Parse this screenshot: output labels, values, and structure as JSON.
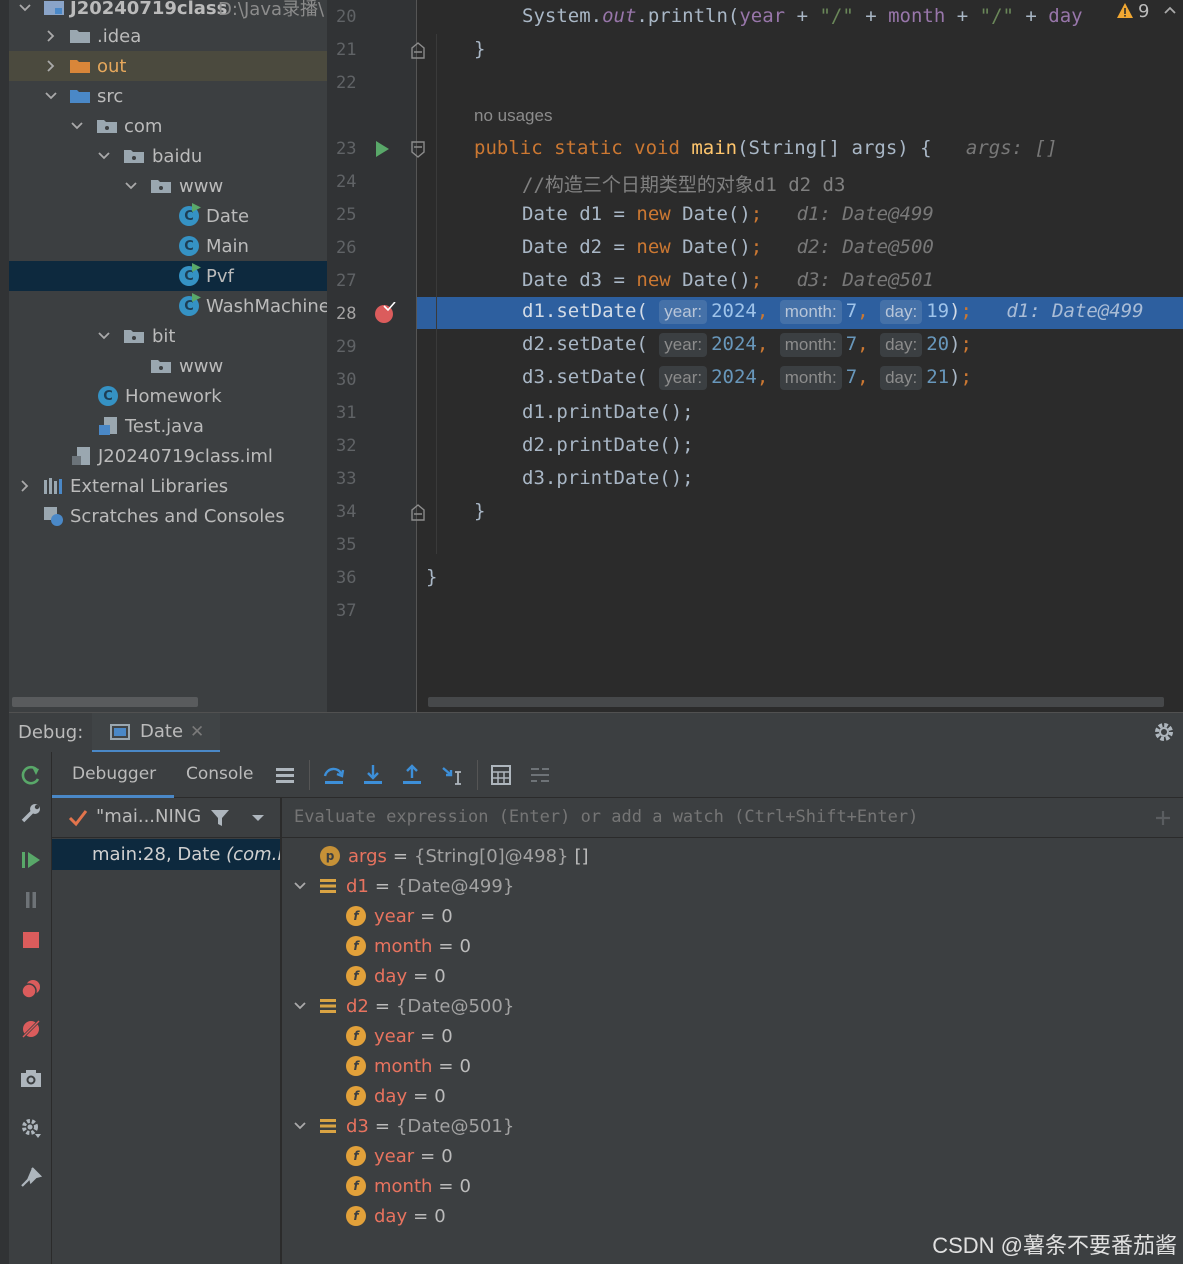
{
  "project_tree": {
    "items": [
      {
        "label": "J20240719class",
        "path": "D:\\Java录播\\"
      },
      {
        "label": ".idea"
      },
      {
        "label": "out"
      },
      {
        "label": "src"
      },
      {
        "label": "com"
      },
      {
        "label": "baidu"
      },
      {
        "label": "www"
      },
      {
        "label": "Date"
      },
      {
        "label": "Main"
      },
      {
        "label": "Pvf"
      },
      {
        "label": "WashMachine"
      },
      {
        "label": "bit"
      },
      {
        "label": "www"
      },
      {
        "label": "Homework"
      },
      {
        "label": "Test.java"
      },
      {
        "label": "J20240719class.iml"
      },
      {
        "label": "External Libraries"
      },
      {
        "label": "Scratches and Consoles"
      }
    ]
  },
  "editor": {
    "warnings_count": "9",
    "line_numbers": [
      "20",
      "21",
      "22",
      "23",
      "24",
      "25",
      "26",
      "27",
      "28",
      "29",
      "30",
      "31",
      "32",
      "33",
      "34",
      "35",
      "36",
      "37"
    ],
    "no_usages": "no usages",
    "inlay_args": "args: []",
    "comment": "//构造三个日期类型的对象d1 d2 d3",
    "inlay_d1": "d1: Date@499",
    "inlay_d2": "d2: Date@500",
    "inlay_d3": "d3: Date@501",
    "inlay_exec": "d1: Date@499",
    "hint_year": "year:",
    "hint_month": "month:",
    "hint_day": "day:",
    "calls": [
      {
        "obj": "d1",
        "year": "2024",
        "month": "7",
        "day": "19"
      },
      {
        "obj": "d2",
        "year": "2024",
        "month": "7",
        "day": "20"
      },
      {
        "obj": "d3",
        "year": "2024",
        "month": "7",
        "day": "21"
      }
    ],
    "print_calls": [
      "d1.printDate();",
      "d2.printDate();",
      "d3.printDate();"
    ]
  },
  "debug": {
    "title": "Debug:",
    "tab": "Date",
    "tabs": {
      "debugger": "Debugger",
      "console": "Console"
    },
    "thread": "\"mai...NING",
    "frame": "main:28, Date",
    "frame_pkg": "(com.ba",
    "eval_placeholder": "Evaluate expression (Enter) or add a watch (Ctrl+Shift+Enter)",
    "variables": [
      {
        "name": "args",
        "eq": "=",
        "value": "{String[0]@498}",
        "extra": "[]"
      },
      {
        "name": "d1",
        "eq": "=",
        "value": "{Date@499}"
      },
      {
        "name": "year",
        "eq": "=",
        "value": "0"
      },
      {
        "name": "month",
        "eq": "=",
        "value": "0"
      },
      {
        "name": "day",
        "eq": "=",
        "value": "0"
      },
      {
        "name": "d2",
        "eq": "=",
        "value": "{Date@500}"
      },
      {
        "name": "year",
        "eq": "=",
        "value": "0"
      },
      {
        "name": "month",
        "eq": "=",
        "value": "0"
      },
      {
        "name": "day",
        "eq": "=",
        "value": "0"
      },
      {
        "name": "d3",
        "eq": "=",
        "value": "{Date@501}"
      },
      {
        "name": "year",
        "eq": "=",
        "value": "0"
      },
      {
        "name": "month",
        "eq": "=",
        "value": "0"
      },
      {
        "name": "day",
        "eq": "=",
        "value": "0"
      }
    ]
  },
  "watermark": "CSDN @薯条不要番茄酱",
  "colors": {
    "accent": "#2d5f9f",
    "keyword": "#cc7832",
    "field_name": "#e8735f",
    "breakpoint": "#db5c5c"
  }
}
